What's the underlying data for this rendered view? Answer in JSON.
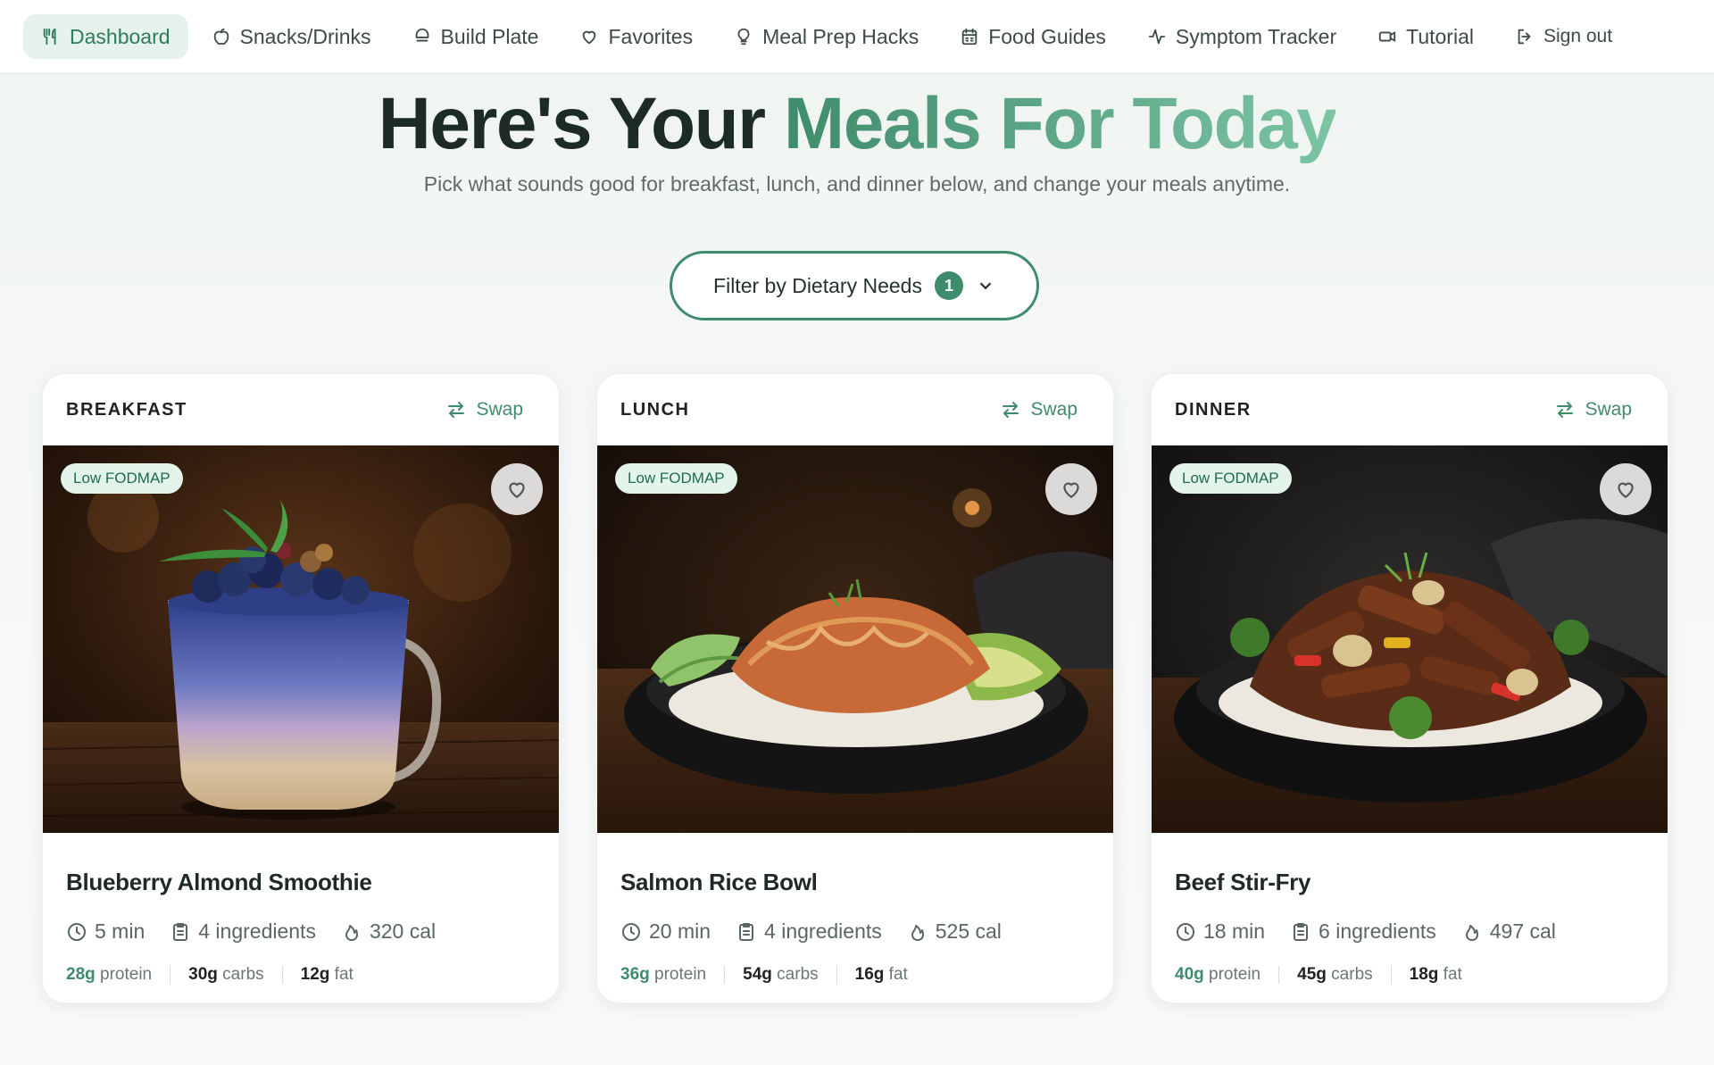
{
  "nav": {
    "items": [
      {
        "label": "Dashboard",
        "icon": "utensils-icon",
        "active": true
      },
      {
        "label": "Snacks/Drinks",
        "icon": "apple-icon"
      },
      {
        "label": "Build Plate",
        "icon": "plate-icon"
      },
      {
        "label": "Favorites",
        "icon": "heart-icon"
      },
      {
        "label": "Meal Prep Hacks",
        "icon": "lightbulb-icon"
      },
      {
        "label": "Food Guides",
        "icon": "calendar-icon"
      },
      {
        "label": "Symptom Tracker",
        "icon": "activity-icon"
      },
      {
        "label": "Tutorial",
        "icon": "video-icon"
      },
      {
        "label": "Sign out",
        "icon": "sign-out-icon"
      }
    ]
  },
  "hero": {
    "title_plain": "Here's Your",
    "title_accent": "Meals For Today",
    "subtitle": "Pick what sounds good for breakfast, lunch, and dinner below, and change your meals anytime."
  },
  "filter": {
    "label": "Filter by Dietary Needs",
    "count": "1"
  },
  "colors": {
    "accent": "#3f8c6b",
    "accent_light": "#7cc4a4",
    "tag_bg": "#e3f5ea"
  },
  "meals": [
    {
      "meal": "BREAKFAST",
      "swap": "Swap",
      "tag": "Low FODMAP",
      "title": "Blueberry Almond Smoothie",
      "time": "5 min",
      "ingredients": "4 ingredients",
      "calories": "320 cal",
      "protein_value": "28g",
      "protein_label": "protein",
      "carbs_value": "30g",
      "carbs_label": "carbs",
      "fat_value": "12g",
      "fat_label": "fat"
    },
    {
      "meal": "LUNCH",
      "swap": "Swap",
      "tag": "Low FODMAP",
      "title": "Salmon Rice Bowl",
      "time": "20 min",
      "ingredients": "4 ingredients",
      "calories": "525 cal",
      "protein_value": "36g",
      "protein_label": "protein",
      "carbs_value": "54g",
      "carbs_label": "carbs",
      "fat_value": "16g",
      "fat_label": "fat"
    },
    {
      "meal": "DINNER",
      "swap": "Swap",
      "tag": "Low FODMAP",
      "title": "Beef Stir-Fry",
      "time": "18 min",
      "ingredients": "6 ingredients",
      "calories": "497 cal",
      "protein_value": "40g",
      "protein_label": "protein",
      "carbs_value": "45g",
      "carbs_label": "carbs",
      "fat_value": "18g",
      "fat_label": "fat"
    }
  ]
}
